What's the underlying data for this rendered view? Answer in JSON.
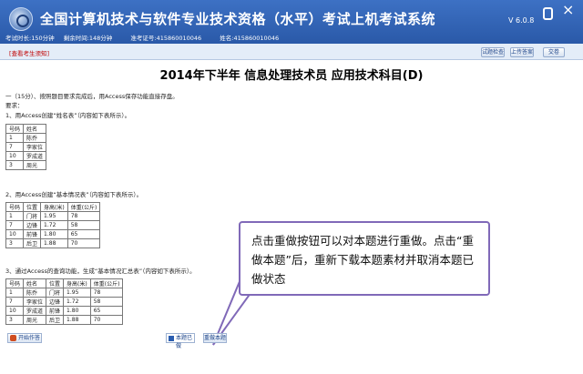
{
  "header": {
    "title": "全国计算机技术与软件专业技术资格（水平）考试上机考试系统",
    "version": "V 6.0.8",
    "exam_duration": "考试时长:150分钟",
    "remaining_time": "剩余时间:148分钟",
    "ticket_no": "准考证号:415860010046",
    "candidate_name": "姓名:415860010046"
  },
  "toolbar": {
    "notice_link": "[查看考生须知]",
    "buttons": [
      "试题检查",
      "上传答案",
      "交卷"
    ]
  },
  "content": {
    "exam_title": "2014年下半年 信息处理技术员 应用技术科目(D)",
    "intro_1": "一（15分）、按照题目要求完成后，用Access保存功能直接存盘。",
    "intro_2": "要求：",
    "req_1": "1、用Access创建“姓名表”（内容如下表所示）。",
    "req_2": "2、用Access创建“基本情况表”（内容如下表所示）。",
    "req_3": "3、通过Access的查询功能，生成“基本情况汇总表”（内容如下表所示）。",
    "table1": {
      "headers": [
        "号码",
        "姓名"
      ],
      "rows": [
        [
          "1",
          "陈乔"
        ],
        [
          "7",
          "李家位"
        ],
        [
          "10",
          "罗成道"
        ],
        [
          "3",
          "周光"
        ]
      ]
    },
    "table2": {
      "headers": [
        "号码",
        "位置",
        "身高(米)",
        "体重(公斤)"
      ],
      "rows": [
        [
          "1",
          "门将",
          "1.95",
          "78"
        ],
        [
          "7",
          "边锋",
          "1.72",
          "58"
        ],
        [
          "10",
          "前锋",
          "1.80",
          "65"
        ],
        [
          "3",
          "后卫",
          "1.88",
          "70"
        ]
      ]
    },
    "table3": {
      "headers": [
        "号码",
        "姓名",
        "位置",
        "身高(米)",
        "体重(公斤)"
      ],
      "rows": [
        [
          "1",
          "陈乔",
          "门将",
          "1.95",
          "78"
        ],
        [
          "7",
          "李家位",
          "边锋",
          "1.72",
          "58"
        ],
        [
          "10",
          "罗成道",
          "前锋",
          "1.80",
          "65"
        ],
        [
          "3",
          "周光",
          "后卫",
          "1.88",
          "70"
        ]
      ]
    }
  },
  "callout": {
    "text": "点击重做按钮可以对本题进行重做。点击“重做本题”后，重新下载本题素材并取消本题已做状态"
  },
  "bottom": {
    "start_label": "开始作答",
    "done_label": "本题已做",
    "redo_label": "重做本题"
  },
  "colors": {
    "header_bg": "#2f5fae",
    "notice": "#c00000",
    "callout_border": "#8069b8"
  }
}
